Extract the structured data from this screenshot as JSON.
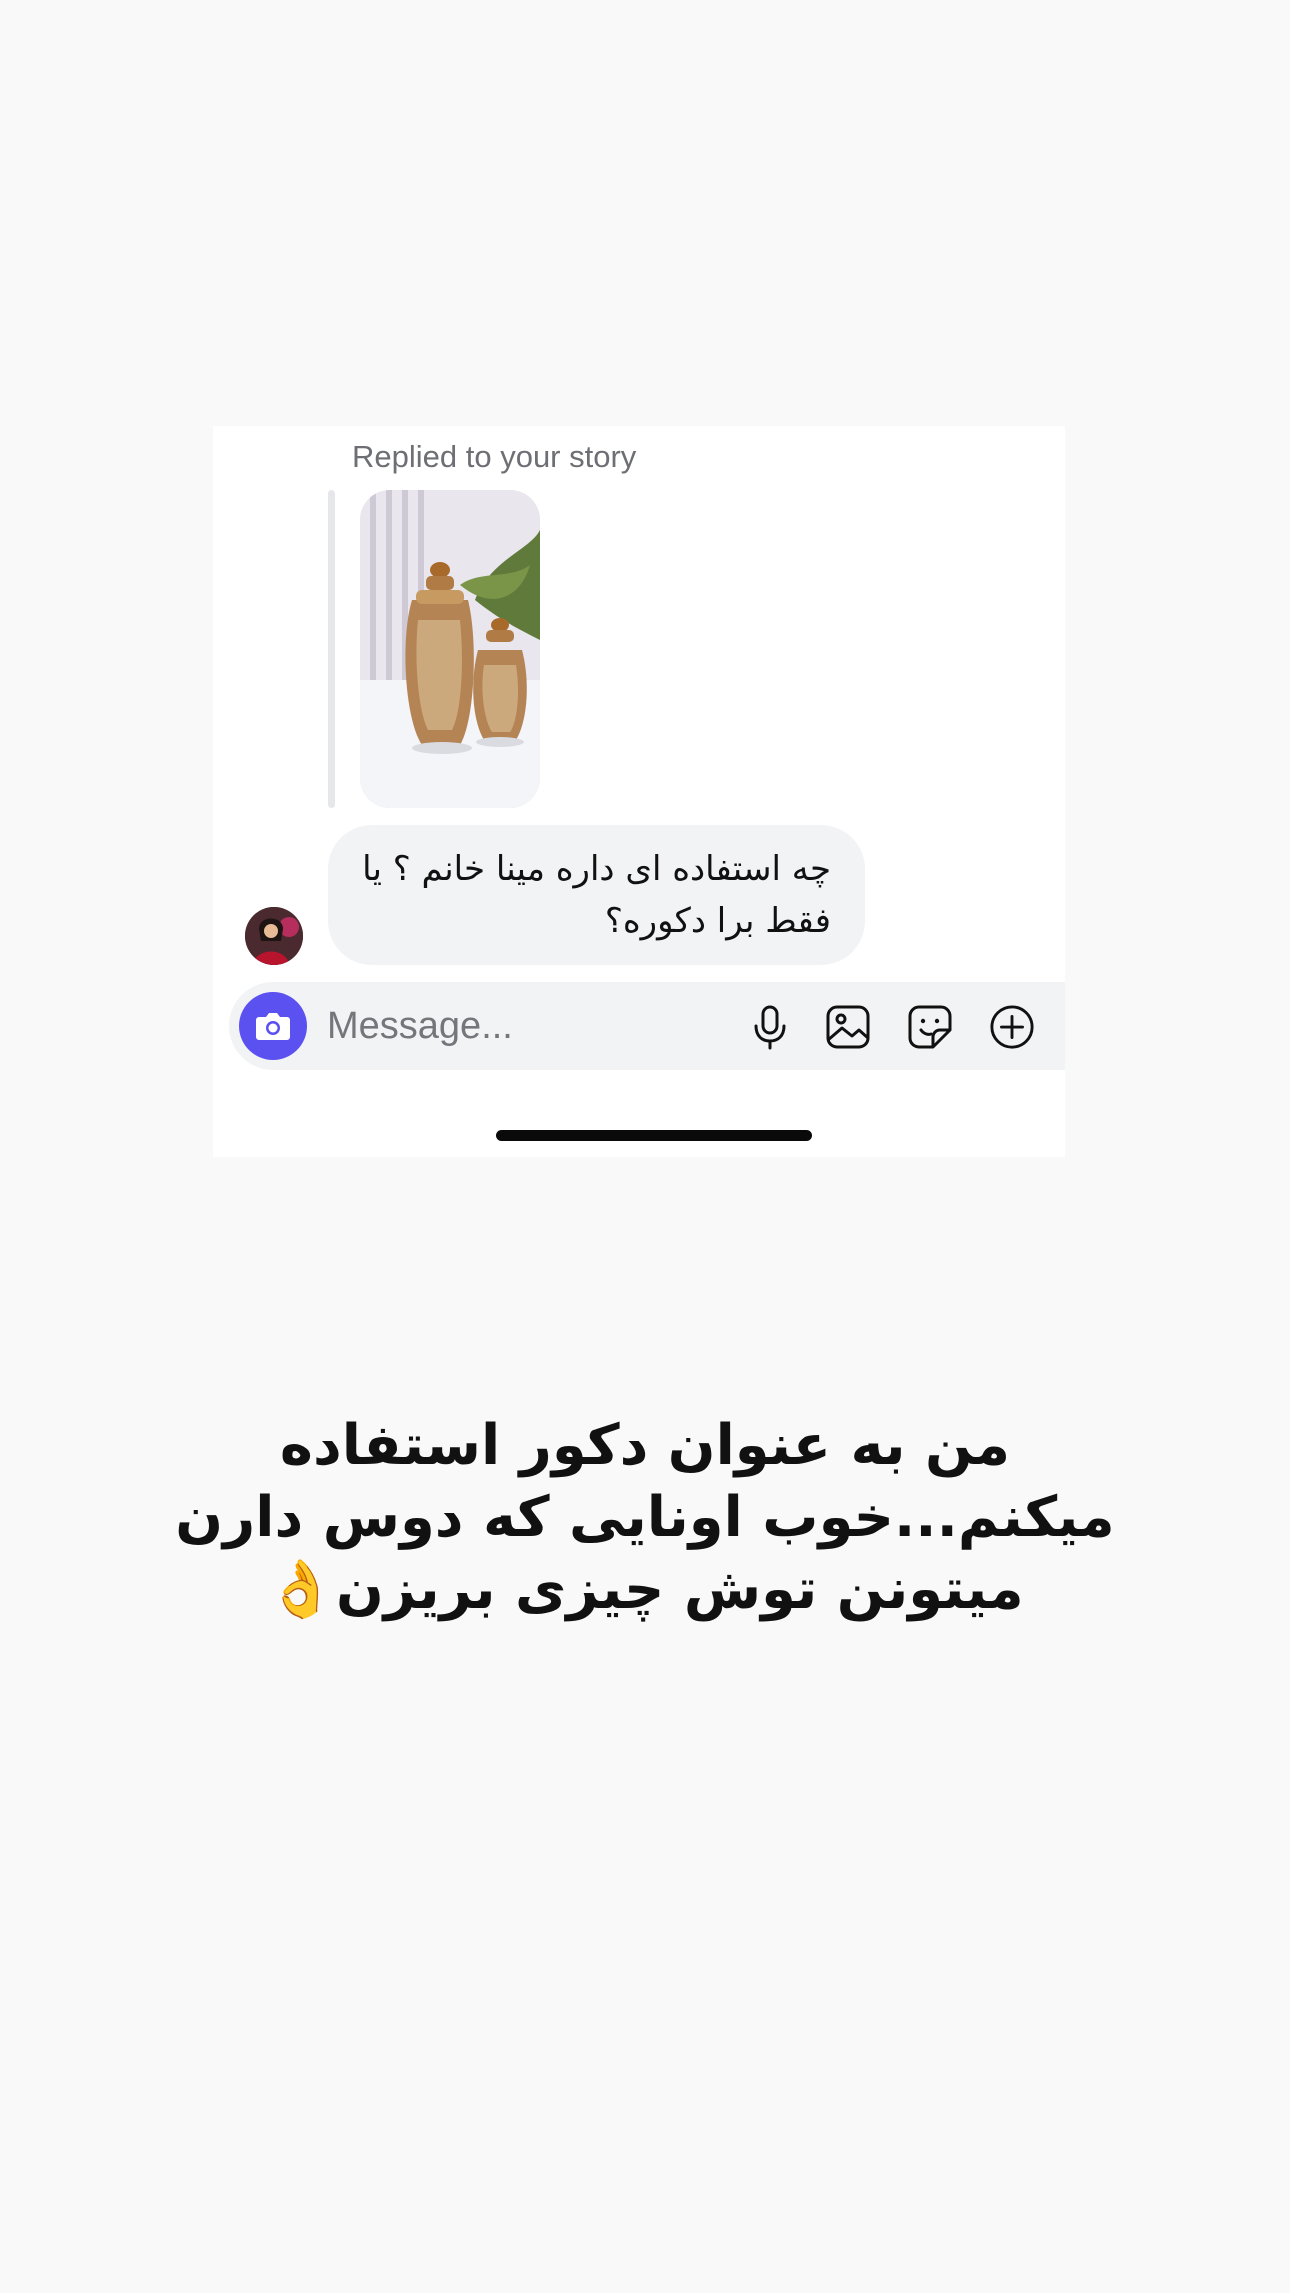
{
  "conversation": {
    "reply_label": "Replied to your story",
    "story_thumbnail_icon": "story-image-vases",
    "incoming_message": "چه استفاده ای داره مینا خانم ؟ یا فقط برا دکوره؟",
    "sender_avatar_icon": "avatar-photo"
  },
  "composer": {
    "placeholder": "Message...",
    "buttons": [
      "camera-icon",
      "microphone-icon",
      "gallery-icon",
      "sticker-icon",
      "plus-icon"
    ],
    "camera_color": "#5b51f0"
  },
  "caption": {
    "text": "من به عنوان دکور استفاده میکنم...خوب اونایی که دوس دارن میتونن توش چیزی بریزن👌"
  }
}
